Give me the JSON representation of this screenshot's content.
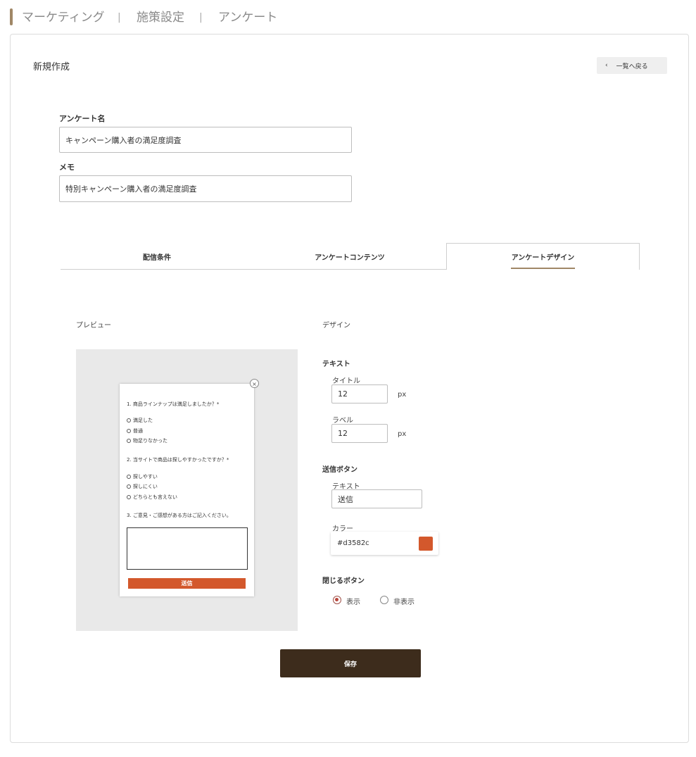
{
  "breadcrumb": [
    "マーケティング",
    "施策設定",
    "アンケート"
  ],
  "breadcrumb_sep": "|",
  "page_title": "新規作成",
  "back_button": {
    "icon": "chevron-left-icon",
    "label": "一覧へ戻る",
    "chevron": "‹"
  },
  "survey_name": {
    "label": "アンケート名",
    "value": "キャンペーン購入者の満足度調査"
  },
  "memo": {
    "label": "メモ",
    "value": "特別キャンペーン購入者の満足度調査"
  },
  "tabs": [
    {
      "label": "配信条件",
      "active": false
    },
    {
      "label": "アンケートコンテンツ",
      "active": false
    },
    {
      "label": "アンケートデザイン",
      "active": true
    }
  ],
  "preview": {
    "heading": "プレビュー",
    "close_glyph": "×",
    "questions": [
      {
        "text": "1. 商品ラインナップは満足しましたか？*",
        "options": [
          "満足した",
          "普通",
          "物足りなかった"
        ]
      },
      {
        "text": "2. 当サイトで商品は探しやすかったですか？*",
        "options": [
          "探しやすい",
          "探しにくい",
          "どちらとも言えない"
        ]
      },
      {
        "text": "3. ご意見・ご感想がある方はご記入ください。",
        "options": []
      }
    ],
    "submit_label": "送信"
  },
  "design": {
    "heading": "デザイン",
    "text_section": {
      "heading": "テキスト",
      "title_label": "タイトル",
      "title_value": "12",
      "label_label": "ラベル",
      "label_value": "12",
      "unit": "px"
    },
    "submit_section": {
      "heading": "送信ボタン",
      "text_label": "テキスト",
      "text_value": "送信",
      "color_label": "カラー",
      "color_value": "#d3582c"
    },
    "close_section": {
      "heading": "閉じるボタン",
      "options": [
        {
          "label": "表示",
          "selected": true
        },
        {
          "label": "非表示",
          "selected": false
        }
      ]
    }
  },
  "save_label": "保存",
  "colors": {
    "accent": "#a08766",
    "submit": "#d3582c",
    "save": "#3d2c1c"
  }
}
